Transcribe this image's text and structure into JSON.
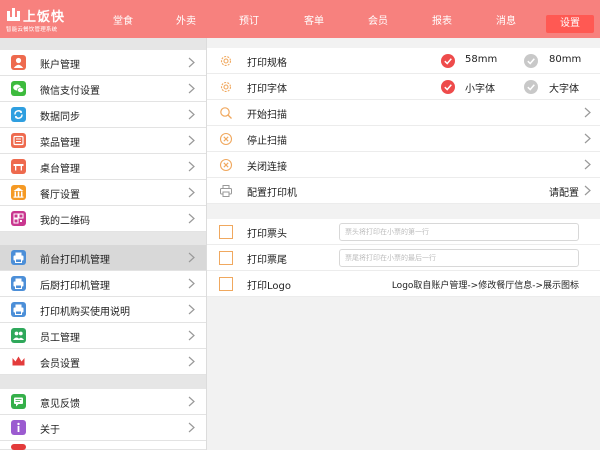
{
  "brand": {
    "name": "上饭快",
    "tagline": "智能云餐饮管理系统",
    "bar_color": "#f7817e",
    "active_color": "#ff5953"
  },
  "nav": {
    "items": [
      "堂食",
      "外卖",
      "预订",
      "客单",
      "会员",
      "报表",
      "消息"
    ],
    "active": "设置"
  },
  "sidebar": {
    "group1": [
      {
        "label": "账户管理",
        "icon": "person-icon",
        "color": "#ee6a4e"
      },
      {
        "label": "微信支付设置",
        "icon": "wechat-icon",
        "color": "#3dbb3d"
      },
      {
        "label": "数据同步",
        "icon": "sync-icon",
        "color": "#2f9fe0"
      },
      {
        "label": "菜品管理",
        "icon": "dish-icon",
        "color": "#ee6a4e"
      },
      {
        "label": "桌台管理",
        "icon": "table-icon",
        "color": "#ee6a4e"
      },
      {
        "label": "餐厅设置",
        "icon": "restaurant-icon",
        "color": "#f59a25"
      },
      {
        "label": "我的二维码",
        "icon": "qrcode-icon",
        "color": "#c9378f"
      }
    ],
    "group2": [
      {
        "label": "前台打印机管理",
        "icon": "printer-icon",
        "color": "#4c8fd8",
        "active": true
      },
      {
        "label": "后厨打印机管理",
        "icon": "printer-icon",
        "color": "#4c8fd8"
      },
      {
        "label": "打印机购买使用说明",
        "icon": "printer-icon",
        "color": "#4c8fd8"
      },
      {
        "label": "员工管理",
        "icon": "staff-icon",
        "color": "#2fa85b"
      },
      {
        "label": "会员设置",
        "icon": "crown-icon",
        "color": "#e33b3b"
      }
    ],
    "group3": [
      {
        "label": "意见反馈",
        "icon": "feedback-icon",
        "color": "#35b04a"
      },
      {
        "label": "关于",
        "icon": "info-icon",
        "color": "#9b5bd0"
      }
    ]
  },
  "printer": {
    "spec_label": "打印规格",
    "spec_options": [
      "58mm",
      "80mm"
    ],
    "spec_selected": "58mm",
    "font_label": "打印字体",
    "font_options": [
      "小字体",
      "大字体"
    ],
    "font_selected": "小字体",
    "start_scan": "开始扫描",
    "stop_scan": "停止扫描",
    "close_conn": "关闭连接",
    "config_label": "配置打印机",
    "config_value": "请配置",
    "accent_color": "#f0a85e",
    "check_color": "#ee4b4b"
  },
  "ticket": {
    "header_label": "打印票头",
    "header_placeholder": "票头将打印在小票的第一行",
    "footer_label": "打印票尾",
    "footer_placeholder": "票尾将打印在小票的最后一行",
    "logo_label": "打印Logo",
    "logo_info": "Logo取自账户管理->修改餐厅信息->展示图标"
  }
}
